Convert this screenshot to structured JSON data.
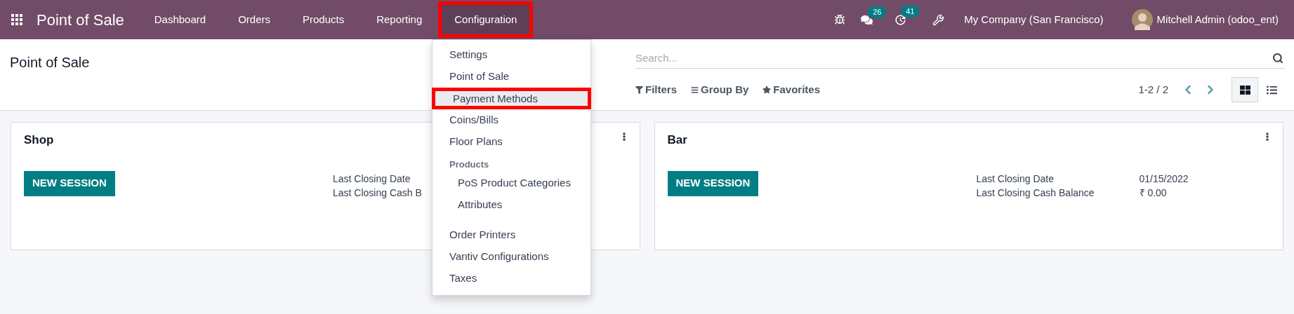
{
  "navbar": {
    "app_title": "Point of Sale",
    "menu": [
      {
        "label": "Dashboard",
        "selected": false,
        "annotated": false
      },
      {
        "label": "Orders",
        "selected": false,
        "annotated": false
      },
      {
        "label": "Products",
        "selected": false,
        "annotated": false
      },
      {
        "label": "Reporting",
        "selected": false,
        "annotated": false
      },
      {
        "label": "Configuration",
        "selected": true,
        "annotated": true
      }
    ],
    "messages_badge": "26",
    "activities_badge": "41",
    "company": "My Company (San Francisco)",
    "user": "Mitchell Admin (odoo_ent)"
  },
  "control_panel": {
    "breadcrumb": "Point of Sale",
    "search": {
      "placeholder": "Search..."
    },
    "search_options": [
      {
        "kind": "filter",
        "label": "Filters"
      },
      {
        "kind": "group",
        "label": "Group By"
      },
      {
        "kind": "favorite",
        "label": "Favorites"
      }
    ],
    "pager": "1-2 / 2",
    "views": [
      {
        "kind": "kanban",
        "selected": true
      },
      {
        "kind": "list",
        "selected": false
      }
    ]
  },
  "cards": [
    {
      "title": "Shop",
      "button": "NEW SESSION",
      "fields": [
        {
          "label": "Last Closing Date"
        },
        {
          "label": "Last Closing Cash B"
        }
      ]
    },
    {
      "title": "Bar",
      "button": "NEW SESSION",
      "fields": [
        {
          "label": "Last Closing Date",
          "value": "01/15/2022"
        },
        {
          "label": "Last Closing Cash Balance",
          "value": "₹ 0.00"
        }
      ]
    }
  ],
  "dropdown": {
    "sections": [
      {
        "items": [
          {
            "label": "Settings",
            "selected": false,
            "annotated": false
          },
          {
            "label": "Point of Sale",
            "selected": false,
            "annotated": false
          },
          {
            "label": "Payment Methods",
            "selected": true,
            "annotated": true
          },
          {
            "label": "Coins/Bills",
            "selected": false,
            "annotated": false
          },
          {
            "label": "Floor Plans",
            "selected": false,
            "annotated": false
          }
        ]
      },
      {
        "header": "Products",
        "items": [
          {
            "label": "PoS Product Categories",
            "selected": false,
            "annotated": false
          },
          {
            "label": "Attributes",
            "selected": false,
            "annotated": false
          }
        ]
      },
      {
        "items": [
          {
            "label": "Order Printers",
            "selected": false,
            "annotated": false
          },
          {
            "label": "Vantiv Configurations",
            "selected": false,
            "annotated": false
          },
          {
            "label": "Taxes",
            "selected": false,
            "annotated": false
          }
        ]
      }
    ]
  }
}
